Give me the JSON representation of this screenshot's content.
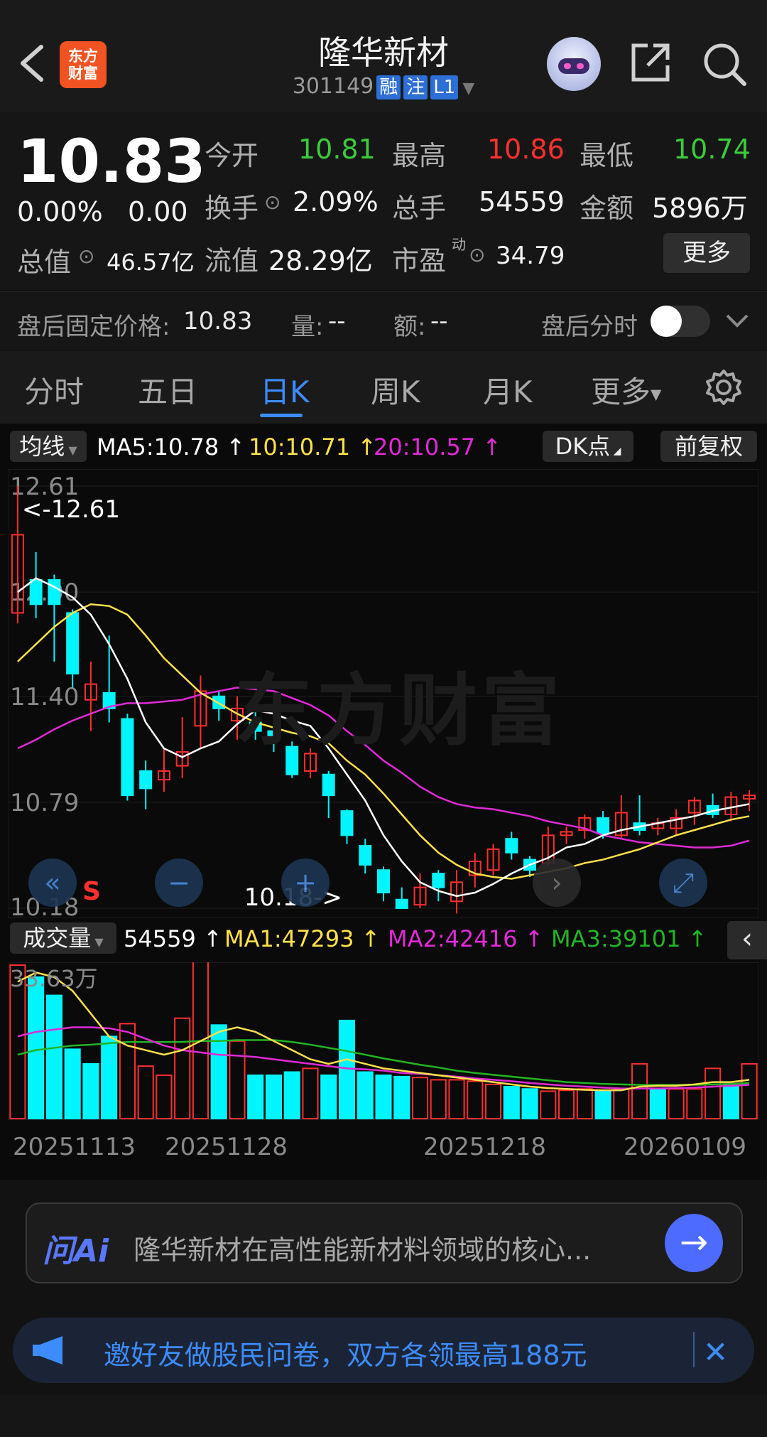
{
  "header": {
    "stock_name": "隆华新材",
    "stock_code": "301149",
    "badges": [
      "融",
      "注",
      "L1"
    ],
    "logo_text": "东方财富",
    "icons": [
      "back-icon",
      "robot-avatar-icon",
      "share-icon",
      "search-icon"
    ]
  },
  "quote": {
    "price": "10.83",
    "change_pct": "0.00%",
    "change": "0.00",
    "open_label": "今开",
    "open": "10.81",
    "high_label": "最高",
    "high": "10.86",
    "low_label": "最低",
    "low": "10.74",
    "turnover_label": "换手",
    "turnover": "2.09%",
    "volume_label": "总手",
    "volume": "54559",
    "amount_label": "金额",
    "amount": "5896万",
    "mktcap_label": "总值",
    "mktcap": "46.57亿",
    "float_label": "流值",
    "float": "28.29亿",
    "pe_label": "市盈",
    "pe_sup": "动",
    "pe": "34.79",
    "more": "更多"
  },
  "afterhours": {
    "price_label": "盘后固定价格:",
    "price": "10.83",
    "vol_label": "量:",
    "vol": "--",
    "amt_label": "额:",
    "amt": "--",
    "timeshare_label": "盘后分时",
    "toggle_on": false
  },
  "tabs": [
    "分时",
    "五日",
    "日K",
    "周K",
    "月K",
    "更多"
  ],
  "active_tab": "日K",
  "indicator_bar": {
    "selector": "均线",
    "ma5": "MA5:10.78",
    "ma10": "10:10.71",
    "ma20": "20:10.57",
    "dk": "DK点",
    "adjust": "前复权",
    "colors": {
      "ma5": "#ffffff",
      "ma10": "#ffe14a",
      "ma20": "#e02ad6"
    }
  },
  "kline": {
    "watermark": "东方财富",
    "y_ticks": [
      "12.61",
      "12.00",
      "11.40",
      "10.79",
      "10.18"
    ],
    "max_marker": "<-12.61",
    "min_marker": "10.18->",
    "s_marker": "S",
    "candles": [
      {
        "o": 11.88,
        "c": 12.33,
        "h": 12.61,
        "l": 11.82
      },
      {
        "o": 12.07,
        "c": 11.93,
        "h": 12.23,
        "l": 11.85
      },
      {
        "o": 12.07,
        "c": 11.93,
        "h": 12.1,
        "l": 11.6
      },
      {
        "o": 11.88,
        "c": 11.53,
        "h": 11.9,
        "l": 11.45
      },
      {
        "o": 11.38,
        "c": 11.47,
        "h": 11.6,
        "l": 11.2
      },
      {
        "o": 11.42,
        "c": 11.33,
        "h": 11.75,
        "l": 11.25
      },
      {
        "o": 11.27,
        "c": 10.83,
        "h": 11.3,
        "l": 10.8
      },
      {
        "o": 10.97,
        "c": 10.87,
        "h": 11.03,
        "l": 10.75
      },
      {
        "o": 10.92,
        "c": 10.97,
        "h": 11.1,
        "l": 10.85
      },
      {
        "o": 11.0,
        "c": 11.08,
        "h": 11.28,
        "l": 10.93
      },
      {
        "o": 11.23,
        "c": 11.43,
        "h": 11.52,
        "l": 11.1
      },
      {
        "o": 11.4,
        "c": 11.33,
        "h": 11.43,
        "l": 11.26
      },
      {
        "o": 11.26,
        "c": 11.33,
        "h": 11.4,
        "l": 11.15
      },
      {
        "o": 11.25,
        "c": 11.2,
        "h": 11.32,
        "l": 11.15
      },
      {
        "o": 11.2,
        "c": 11.16,
        "h": 11.26,
        "l": 11.08
      },
      {
        "o": 11.11,
        "c": 10.95,
        "h": 11.14,
        "l": 10.93
      },
      {
        "o": 10.97,
        "c": 11.07,
        "h": 11.1,
        "l": 10.93
      },
      {
        "o": 10.95,
        "c": 10.83,
        "h": 10.97,
        "l": 10.7
      },
      {
        "o": 10.74,
        "c": 10.6,
        "h": 10.75,
        "l": 10.55
      },
      {
        "o": 10.54,
        "c": 10.43,
        "h": 10.58,
        "l": 10.38
      },
      {
        "o": 10.4,
        "c": 10.27,
        "h": 10.42,
        "l": 10.22
      },
      {
        "o": 10.23,
        "c": 10.18,
        "h": 10.3,
        "l": 10.18
      },
      {
        "o": 10.2,
        "c": 10.3,
        "h": 10.38,
        "l": 10.18
      },
      {
        "o": 10.38,
        "c": 10.3,
        "h": 10.4,
        "l": 10.22
      },
      {
        "o": 10.22,
        "c": 10.33,
        "h": 10.4,
        "l": 10.15
      },
      {
        "o": 10.37,
        "c": 10.45,
        "h": 10.5,
        "l": 10.3
      },
      {
        "o": 10.4,
        "c": 10.52,
        "h": 10.55,
        "l": 10.37
      },
      {
        "o": 10.58,
        "c": 10.5,
        "h": 10.62,
        "l": 10.46
      },
      {
        "o": 10.46,
        "c": 10.4,
        "h": 10.48,
        "l": 10.36
      },
      {
        "o": 10.44,
        "c": 10.6,
        "h": 10.65,
        "l": 10.42
      },
      {
        "o": 10.6,
        "c": 10.62,
        "h": 10.65,
        "l": 10.55
      },
      {
        "o": 10.63,
        "c": 10.7,
        "h": 10.72,
        "l": 10.58
      },
      {
        "o": 10.7,
        "c": 10.61,
        "h": 10.74,
        "l": 10.58
      },
      {
        "o": 10.6,
        "c": 10.73,
        "h": 10.83,
        "l": 10.58
      },
      {
        "o": 10.67,
        "c": 10.63,
        "h": 10.83,
        "l": 10.6
      },
      {
        "o": 10.64,
        "c": 10.67,
        "h": 10.7,
        "l": 10.6
      },
      {
        "o": 10.64,
        "c": 10.7,
        "h": 10.75,
        "l": 10.6
      },
      {
        "o": 10.73,
        "c": 10.8,
        "h": 10.82,
        "l": 10.66
      },
      {
        "o": 10.77,
        "c": 10.72,
        "h": 10.84,
        "l": 10.7
      },
      {
        "o": 10.72,
        "c": 10.82,
        "h": 10.85,
        "l": 10.68
      },
      {
        "o": 10.81,
        "c": 10.83,
        "h": 10.86,
        "l": 10.74
      }
    ],
    "ma5": [
      12.0,
      12.08,
      12.03,
      11.97,
      11.87,
      11.7,
      11.5,
      11.25,
      11.1,
      11.05,
      11.1,
      11.14,
      11.24,
      11.32,
      11.3,
      11.26,
      11.23,
      11.1,
      10.95,
      10.8,
      10.6,
      10.45,
      10.33,
      10.28,
      10.25,
      10.27,
      10.32,
      10.38,
      10.43,
      10.47,
      10.53,
      10.55,
      10.6,
      10.63,
      10.65,
      10.67,
      10.69,
      10.71,
      10.74,
      10.76,
      10.78
    ],
    "ma10": [
      11.6,
      11.7,
      11.8,
      11.88,
      11.93,
      11.92,
      11.87,
      11.75,
      11.62,
      11.52,
      11.42,
      11.36,
      11.3,
      11.25,
      11.22,
      11.19,
      11.17,
      11.13,
      11.03,
      10.95,
      10.84,
      10.72,
      10.6,
      10.5,
      10.43,
      10.38,
      10.36,
      10.35,
      10.37,
      10.39,
      10.41,
      10.44,
      10.46,
      10.49,
      10.52,
      10.56,
      10.6,
      10.63,
      10.66,
      10.69,
      10.71
    ],
    "ma20": [
      11.1,
      11.15,
      11.21,
      11.26,
      11.3,
      11.34,
      11.36,
      11.36,
      11.37,
      11.38,
      11.41,
      11.43,
      11.45,
      11.44,
      11.43,
      11.39,
      11.35,
      11.29,
      11.2,
      11.12,
      11.03,
      10.96,
      10.88,
      10.82,
      10.78,
      10.76,
      10.75,
      10.73,
      10.71,
      10.68,
      10.66,
      10.64,
      10.6,
      10.58,
      10.56,
      10.55,
      10.54,
      10.53,
      10.53,
      10.54,
      10.57
    ]
  },
  "volume_bar": {
    "selector": "成交量",
    "vol": "54559",
    "ma1": "MA1:47293",
    "ma2": "MA2:42416",
    "ma3": "MA3:39101",
    "colors": {
      "vol": "#ffffff",
      "ma1": "#ffe14a",
      "ma2": "#e02ad6",
      "ma3": "#22b522"
    }
  },
  "volume_chart": {
    "max_label": "33.63万",
    "values": [
      336300,
      310000,
      270000,
      152000,
      120000,
      180000,
      208000,
      115000,
      95000,
      220000,
      358000,
      205000,
      170000,
      95000,
      95000,
      102000,
      110000,
      95000,
      215000,
      102000,
      95000,
      92000,
      90000,
      85000,
      85000,
      82000,
      75000,
      70000,
      65000,
      60000,
      62000,
      65000,
      60000,
      65000,
      120000,
      65000,
      65000,
      65000,
      110000,
      75000,
      120000
    ],
    "up": [
      true,
      false,
      false,
      false,
      false,
      false,
      true,
      true,
      true,
      true,
      true,
      false,
      true,
      false,
      false,
      false,
      true,
      false,
      false,
      false,
      false,
      false,
      true,
      true,
      true,
      true,
      true,
      false,
      false,
      true,
      true,
      true,
      false,
      true,
      true,
      false,
      true,
      true,
      true,
      false,
      true
    ],
    "ma1": [
      300000,
      320000,
      310000,
      280000,
      230000,
      180000,
      160000,
      150000,
      140000,
      150000,
      170000,
      190000,
      200000,
      190000,
      170000,
      150000,
      130000,
      120000,
      130000,
      120000,
      110000,
      105000,
      100000,
      95000,
      90000,
      85000,
      80000,
      75000,
      70000,
      67000,
      65000,
      63000,
      62000,
      62000,
      70000,
      72000,
      72000,
      75000,
      80000,
      80000,
      85000
    ],
    "ma2": [
      180000,
      190000,
      195000,
      200000,
      200000,
      198000,
      190000,
      175000,
      160000,
      150000,
      145000,
      140000,
      138000,
      135000,
      130000,
      125000,
      120000,
      115000,
      110000,
      108000,
      105000,
      100000,
      98000,
      95000,
      92000,
      88000,
      85000,
      82000,
      78000,
      75000,
      72000,
      70000,
      68000,
      66000,
      66000,
      66000,
      67000,
      68000,
      70000,
      72000,
      74000
    ],
    "ma3": [
      140000,
      150000,
      155000,
      160000,
      162000,
      165000,
      168000,
      168000,
      168000,
      168000,
      170000,
      170000,
      172000,
      172000,
      172000,
      168000,
      162000,
      155000,
      148000,
      140000,
      132000,
      125000,
      118000,
      112000,
      105000,
      100000,
      96000,
      92000,
      88000,
      84000,
      80000,
      78000,
      76000,
      75000,
      74000,
      74000,
      74000,
      74000,
      75000,
      76000,
      78000
    ]
  },
  "x_dates": [
    "20251113",
    "20251128",
    "20251218",
    "20260109"
  ],
  "ai_bar": {
    "logo": "问Ai",
    "prompt": "隆华新材在高性能新材料领域的核心..."
  },
  "promo": {
    "text": "邀好友做股民问卷，双方各领最高188元"
  },
  "colors": {
    "up": "#ff2e2e",
    "down": "#00f5ff",
    "accent": "#3c8cff"
  }
}
